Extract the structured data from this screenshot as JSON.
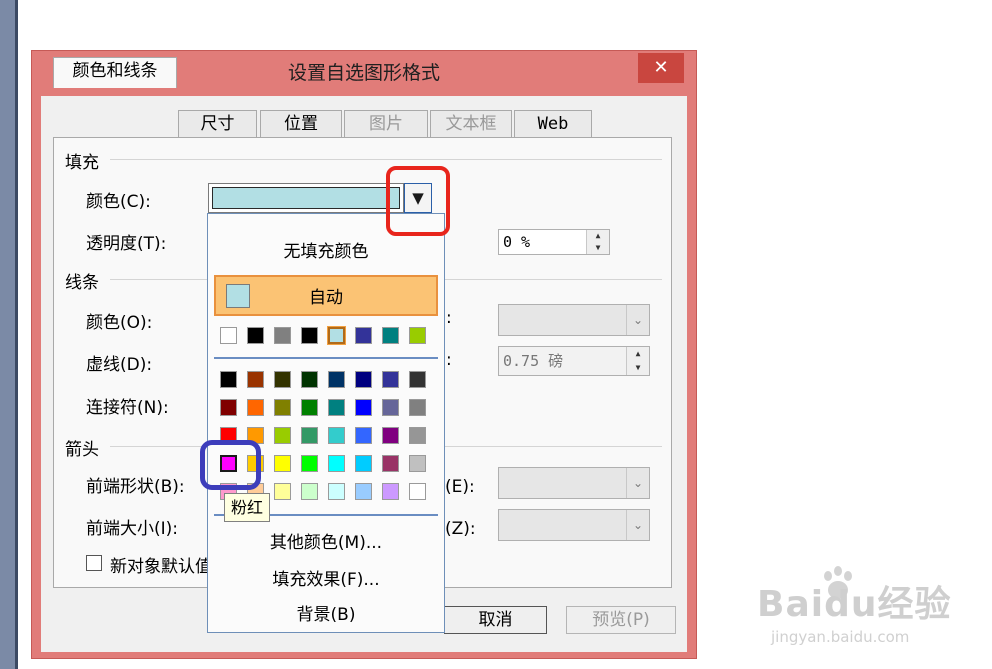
{
  "dialog": {
    "title": "设置自选图形格式",
    "close": "✕"
  },
  "tabs": [
    {
      "label": "颜色和线条",
      "state": "active"
    },
    {
      "label": "尺寸",
      "state": "normal"
    },
    {
      "label": "位置",
      "state": "normal"
    },
    {
      "label": "图片",
      "state": "disabled"
    },
    {
      "label": "文本框",
      "state": "disabled"
    },
    {
      "label": "Web",
      "state": "normal"
    }
  ],
  "fill": {
    "section": "填充",
    "color_label": "颜色(C):",
    "color_value": "#b2dfe4",
    "transparency_label": "透明度(T):",
    "transparency_value": "0 %"
  },
  "line": {
    "section": "线条",
    "color_label": "颜色(O):",
    "dash_label": "虚线(D):",
    "connector_label": "连接符(N):",
    "weight_value": "0.75 磅",
    "colon": ":"
  },
  "arrows": {
    "section": "箭头",
    "begin_style_label": "前端形状(B):",
    "begin_size_label": "前端大小(I):",
    "end_style_suffix": "状(E):",
    "end_size_suffix": "小(Z):"
  },
  "default_checkbox": "新对象默认值",
  "buttons": {
    "cancel": "取消",
    "preview": "预览(P)"
  },
  "popup": {
    "no_fill": "无填充颜色",
    "automatic": "自动",
    "more_colors": "其他颜色(M)...",
    "fill_effects": "填充效果(F)...",
    "background": "背景(B)",
    "recent_colors": [
      "#ffffff",
      "#000000",
      "#808080",
      "#000000",
      "#b2dfe4",
      "#333399",
      "#008080",
      "#99cc00"
    ],
    "palette": [
      [
        "#000000",
        "#993300",
        "#333300",
        "#003300",
        "#003366",
        "#000080",
        "#333399",
        "#333333"
      ],
      [
        "#800000",
        "#ff6600",
        "#808000",
        "#008000",
        "#008080",
        "#0000ff",
        "#666699",
        "#808080"
      ],
      [
        "#ff0000",
        "#ff9900",
        "#99cc00",
        "#339966",
        "#33cccc",
        "#3366ff",
        "#800080",
        "#969696"
      ],
      [
        "#ff00ff",
        "#ffcc00",
        "#ffff00",
        "#00ff00",
        "#00ffff",
        "#00ccff",
        "#993366",
        "#c0c0c0"
      ],
      [
        "#ff99cc",
        "#ffcc99",
        "#ffff99",
        "#ccffcc",
        "#ccffff",
        "#99ccff",
        "#cc99ff",
        "#ffffff"
      ]
    ],
    "tooltip": "粉红"
  },
  "watermark": {
    "brand": "Baidu经验",
    "url": "jingyan.baidu.com"
  }
}
